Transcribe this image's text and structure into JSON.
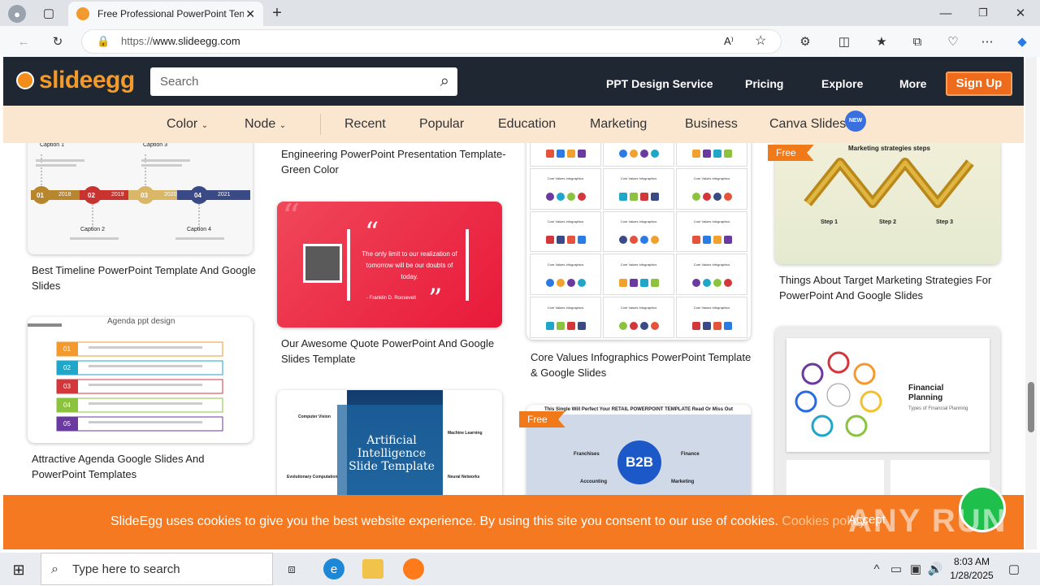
{
  "browser": {
    "tab_title": "Free Professional PowerPoint Ten",
    "url_prefix": "https://",
    "url_host": "www.slideegg.com",
    "new_tab": "+"
  },
  "site": {
    "logo_text": "slideegg",
    "search_placeholder": "Search",
    "nav": [
      "PPT Design Service",
      "Pricing",
      "Explore",
      "More"
    ],
    "signup": "Sign Up",
    "subnav": {
      "color": "Color",
      "node": "Node",
      "links": [
        "Recent",
        "Popular",
        "Education",
        "Marketing",
        "Business",
        "Canva Slides"
      ],
      "new_badge": "NEW"
    }
  },
  "cards": {
    "c1_caption": "Best Timeline PowerPoint Template And Google Slides",
    "c1_labels": [
      "Caption 1",
      "Caption 3",
      "Caption 2",
      "Caption 4"
    ],
    "c1_years": [
      "01",
      "2018",
      "02",
      "2019",
      "03",
      "2020",
      "04",
      "2021"
    ],
    "c2_caption": "Attractive Agenda Google Slides And PowerPoint Templates",
    "c2_title": "Agenda ppt design",
    "c2_nums": [
      "01",
      "02",
      "03",
      "04",
      "05"
    ],
    "c3_caption_top": "Engineering PowerPoint Presentation Template-Green Color",
    "c3_quote": "The only limit to our realization of tomorrow will be our doubts of today.",
    "c3_author": "- Franklin D. Roosevelt",
    "c3_caption": "Our Awesome Quote PowerPoint And Google Slides Template",
    "c4_title": "Artificial Intelligence Slide Template",
    "c4_labels": [
      "Computer Vision",
      "Machine Learning",
      "Evolutionary Computation",
      "Neural Networks"
    ],
    "c5_caption": "Core Values Infographics PowerPoint Template & Google Slides",
    "c5_tile": "Core Values Infographics",
    "c6_header": "This Single Will Perfect Your RETAIL POWERPOINT TEMPLATE Read Or Miss Out",
    "c6_center": "B2B",
    "c6_labels": [
      "Franchises",
      "Finance",
      "Accounting",
      "Marketing"
    ],
    "c7_title": "Marketing strategies steps",
    "c7_steps": [
      "Step 1",
      "Step 2",
      "Step 3"
    ],
    "c7_caption": "Things About Target Marketing Strategies For PowerPoint And Google Slides",
    "c8_title": "Financial Planning",
    "c8_sub": "Types of Financial Planning",
    "free": "Free"
  },
  "cookie": {
    "message": "SlideEgg uses cookies to give you the best website experience. By using this site you consent to our use of cookies.",
    "link": "Cookies policy.",
    "accept": "Accept"
  },
  "taskbar": {
    "search": "Type here to search",
    "time": "8:03 AM",
    "date": "1/28/2025"
  },
  "watermark": "ANY RUN"
}
